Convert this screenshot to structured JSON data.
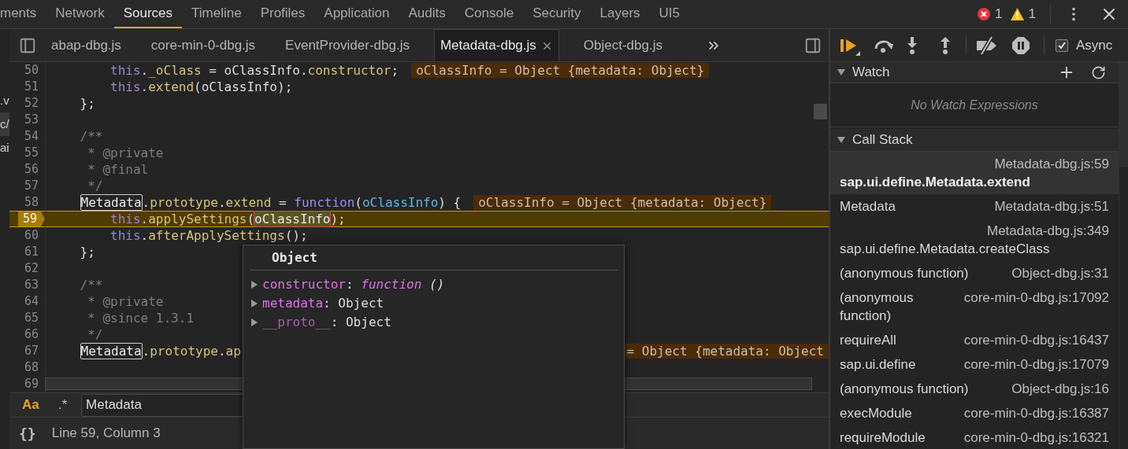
{
  "devtools_tabs": [
    {
      "label": "ments",
      "selected": false
    },
    {
      "label": "Network",
      "selected": false
    },
    {
      "label": "Sources",
      "selected": true
    },
    {
      "label": "Timeline",
      "selected": false
    },
    {
      "label": "Profiles",
      "selected": false
    },
    {
      "label": "Application",
      "selected": false
    },
    {
      "label": "Audits",
      "selected": false
    },
    {
      "label": "Console",
      "selected": false
    },
    {
      "label": "Security",
      "selected": false
    },
    {
      "label": "Layers",
      "selected": false
    },
    {
      "label": "UI5",
      "selected": false
    }
  ],
  "issue_counts": {
    "errors": "1",
    "warnings": "1"
  },
  "navigator_fragments": [
    {
      "text": ".v",
      "selected": false
    },
    {
      "text": "c/",
      "selected": true
    },
    {
      "text": "ai",
      "selected": false
    }
  ],
  "file_tabs": [
    {
      "label": "abap-dbg.js",
      "selected": false
    },
    {
      "label": "core-min-0-dbg.js",
      "selected": false
    },
    {
      "label": "EventProvider-dbg.js",
      "selected": false
    },
    {
      "label": "Metadata-dbg.js",
      "selected": true
    },
    {
      "label": "Object-dbg.js",
      "selected": false
    }
  ],
  "code_lines": [
    {
      "number": "50",
      "current": false,
      "tokens": [
        {
          "text": "        this",
          "kind": "keyword"
        },
        {
          "text": ".",
          "kind": "plain"
        },
        {
          "text": "_oClass",
          "kind": "property"
        },
        {
          "text": " = oClassInfo.",
          "kind": "plain"
        },
        {
          "text": "constructor",
          "kind": "property"
        },
        {
          "text": ";",
          "kind": "plain"
        }
      ],
      "inline_value": "oClassInfo = Object {metadata: Object}"
    },
    {
      "number": "51",
      "current": false,
      "tokens": [
        {
          "text": "        this",
          "kind": "keyword"
        },
        {
          "text": ".",
          "kind": "plain"
        },
        {
          "text": "extend",
          "kind": "property"
        },
        {
          "text": "(oClassInfo);",
          "kind": "plain"
        }
      ]
    },
    {
      "number": "52",
      "current": false,
      "tokens": [
        {
          "text": "    };",
          "kind": "plain"
        }
      ]
    },
    {
      "number": "53",
      "current": false
    },
    {
      "number": "54",
      "current": false,
      "tokens": [
        {
          "text": "    /**",
          "kind": "comment"
        }
      ]
    },
    {
      "number": "55",
      "current": false,
      "tokens": [
        {
          "text": "     * @private",
          "kind": "comment"
        }
      ]
    },
    {
      "number": "56",
      "current": false,
      "tokens": [
        {
          "text": "     * @final",
          "kind": "comment"
        }
      ]
    },
    {
      "number": "57",
      "current": false,
      "tokens": [
        {
          "text": "     */",
          "kind": "comment"
        }
      ]
    },
    {
      "number": "58",
      "current": false,
      "tokens": [
        {
          "text": "    Metadata",
          "kind": "match"
        },
        {
          "text": ".",
          "kind": "plain"
        },
        {
          "text": "prototype",
          "kind": "property"
        },
        {
          "text": ".",
          "kind": "plain"
        },
        {
          "text": "extend",
          "kind": "property"
        },
        {
          "text": " = ",
          "kind": "plain"
        },
        {
          "text": "function",
          "kind": "function"
        },
        {
          "text": "(",
          "kind": "plain"
        },
        {
          "text": "oClassInfo",
          "kind": "param"
        },
        {
          "text": ") {",
          "kind": "plain"
        }
      ],
      "inline_value": "oClassInfo = Object {metadata: Object}"
    },
    {
      "number": "59",
      "current": true,
      "tokens": [
        {
          "text": "        this",
          "kind": "keyword"
        },
        {
          "text": ".",
          "kind": "plain"
        },
        {
          "text": "applySettings",
          "kind": "property"
        },
        {
          "text": "(",
          "kind": "plain"
        },
        {
          "text": "oClassInfo",
          "kind": "hovered"
        },
        {
          "text": ");",
          "kind": "plain"
        }
      ]
    },
    {
      "number": "60",
      "current": false,
      "tokens": [
        {
          "text": "        this",
          "kind": "keyword"
        },
        {
          "text": ".",
          "kind": "plain"
        },
        {
          "text": "afterApplySettings",
          "kind": "property"
        },
        {
          "text": "();",
          "kind": "plain"
        }
      ]
    },
    {
      "number": "61",
      "current": false,
      "tokens": [
        {
          "text": "    };",
          "kind": "plain"
        }
      ]
    },
    {
      "number": "62",
      "current": false
    },
    {
      "number": "63",
      "current": false,
      "tokens": [
        {
          "text": "    /**",
          "kind": "comment"
        }
      ]
    },
    {
      "number": "64",
      "current": false,
      "tokens": [
        {
          "text": "     * @private",
          "kind": "comment"
        }
      ]
    },
    {
      "number": "65",
      "current": false,
      "tokens": [
        {
          "text": "     * @since 1.3.1",
          "kind": "comment"
        }
      ]
    },
    {
      "number": "66",
      "current": false,
      "tokens": [
        {
          "text": "     */",
          "kind": "comment"
        }
      ]
    },
    {
      "number": "67",
      "current": false,
      "tokens": [
        {
          "text": "    Metadata",
          "kind": "match"
        },
        {
          "text": ".",
          "kind": "plain"
        },
        {
          "text": "prototype",
          "kind": "property"
        },
        {
          "text": ".",
          "kind": "plain"
        },
        {
          "text": "ap",
          "kind": "property"
        }
      ],
      "inline_value": "= Object {metadata: Object",
      "partly_hidden": true
    },
    {
      "number": "68",
      "current": false
    },
    {
      "number": "69",
      "current": false
    }
  ],
  "popover": {
    "title": "Object",
    "properties": [
      {
        "key": "constructor",
        "separator": ":",
        "internal": false,
        "value": [
          {
            "text": "function",
            "kind": "function"
          },
          {
            "text": " ()",
            "kind": "plain"
          }
        ]
      },
      {
        "key": "metadata",
        "separator": ":",
        "internal": false,
        "value": [
          {
            "text": "Object",
            "kind": "object"
          }
        ]
      },
      {
        "key": "__proto__",
        "separator": ":",
        "internal": true,
        "value": [
          {
            "text": "Object",
            "kind": "object"
          }
        ]
      }
    ]
  },
  "search": {
    "toggles": [
      {
        "label": "Aa",
        "on": true
      },
      {
        "label": ".*",
        "on": false
      }
    ],
    "value": "Metadata"
  },
  "status": {
    "format_button": "{}",
    "position": "Line 59, Column 3"
  },
  "debugger": {
    "async": {
      "label": "Async",
      "checked": true
    },
    "watch": {
      "title": "Watch",
      "expanded": true,
      "empty_message": "No Watch Expressions"
    },
    "call_stack": {
      "title": "Call Stack",
      "expanded": true,
      "frames": [
        {
          "function": "sap.ui.define.Metadata.extend",
          "location": "Metadata-dbg.js:59",
          "selected": true
        },
        {
          "function": "Metadata",
          "location": "Metadata-dbg.js:51",
          "selected": false
        },
        {
          "function": "sap.ui.define.Metadata.createClass",
          "location": "Metadata-dbg.js:349",
          "selected": false
        },
        {
          "function": "(anonymous function)",
          "location": "Object-dbg.js:31",
          "selected": false
        },
        {
          "function": "(anonymous function)",
          "location": "core-min-0-dbg.js:17092",
          "selected": false
        },
        {
          "function": "requireAll",
          "location": "core-min-0-dbg.js:16437",
          "selected": false
        },
        {
          "function": "sap.ui.define",
          "location": "core-min-0-dbg.js:17079",
          "selected": false
        },
        {
          "function": "(anonymous function)",
          "location": "Object-dbg.js:16",
          "selected": false
        },
        {
          "function": "execModule",
          "location": "core-min-0-dbg.js:16387",
          "selected": false
        },
        {
          "function": "requireModule",
          "location": "core-min-0-dbg.js:16321",
          "selected": false
        }
      ]
    }
  }
}
